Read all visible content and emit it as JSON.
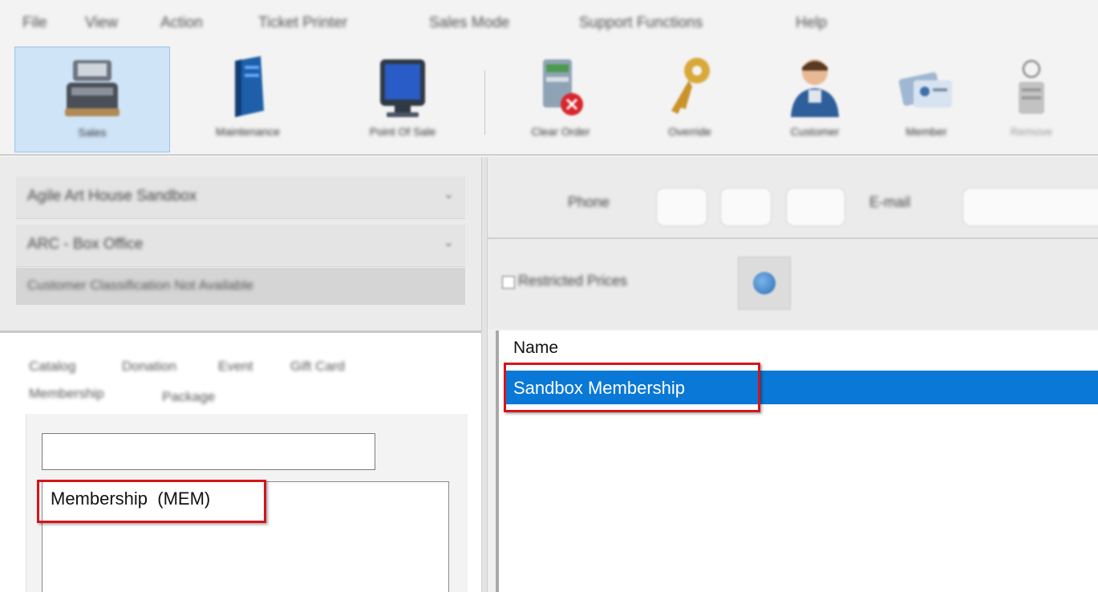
{
  "menu": {
    "items": [
      "File",
      "View",
      "Action",
      "Ticket Printer",
      "Sales Mode",
      "Support Functions",
      "Help"
    ]
  },
  "toolbar": {
    "buttons": [
      {
        "label": "Sales",
        "icon": "register-icon"
      },
      {
        "label": "Maintenance",
        "icon": "server-icon"
      },
      {
        "label": "Point Of Sale",
        "icon": "monitor-icon"
      },
      {
        "label": "Clear Order",
        "icon": "clear-order-icon"
      },
      {
        "label": "Override",
        "icon": "key-icon"
      },
      {
        "label": "Customer",
        "icon": "customer-icon"
      },
      {
        "label": "Member",
        "icon": "member-card-icon"
      },
      {
        "label": "Remove",
        "icon": "remove-icon"
      }
    ]
  },
  "left_panel": {
    "venue_combo": "Agile Art House Sandbox",
    "location_combo": "ARC - Box Office",
    "classification_label": "Customer Classification Not Available"
  },
  "right_panel": {
    "phone_label": "Phone",
    "email_label": "E-mail",
    "restricted_label": "Restricted Prices"
  },
  "catalog": {
    "tabs_row1": [
      "Catalog",
      "Donation",
      "Event",
      "Gift Card"
    ],
    "tabs_row2": [
      "Membership",
      "Package"
    ],
    "search_value": "",
    "list_items": [
      "Membership  (MEM)"
    ]
  },
  "results": {
    "column_header": "Name",
    "selected_item": "Sandbox Membership"
  },
  "colors": {
    "selection": "#0a78d7",
    "highlight_box": "#d4151b"
  }
}
